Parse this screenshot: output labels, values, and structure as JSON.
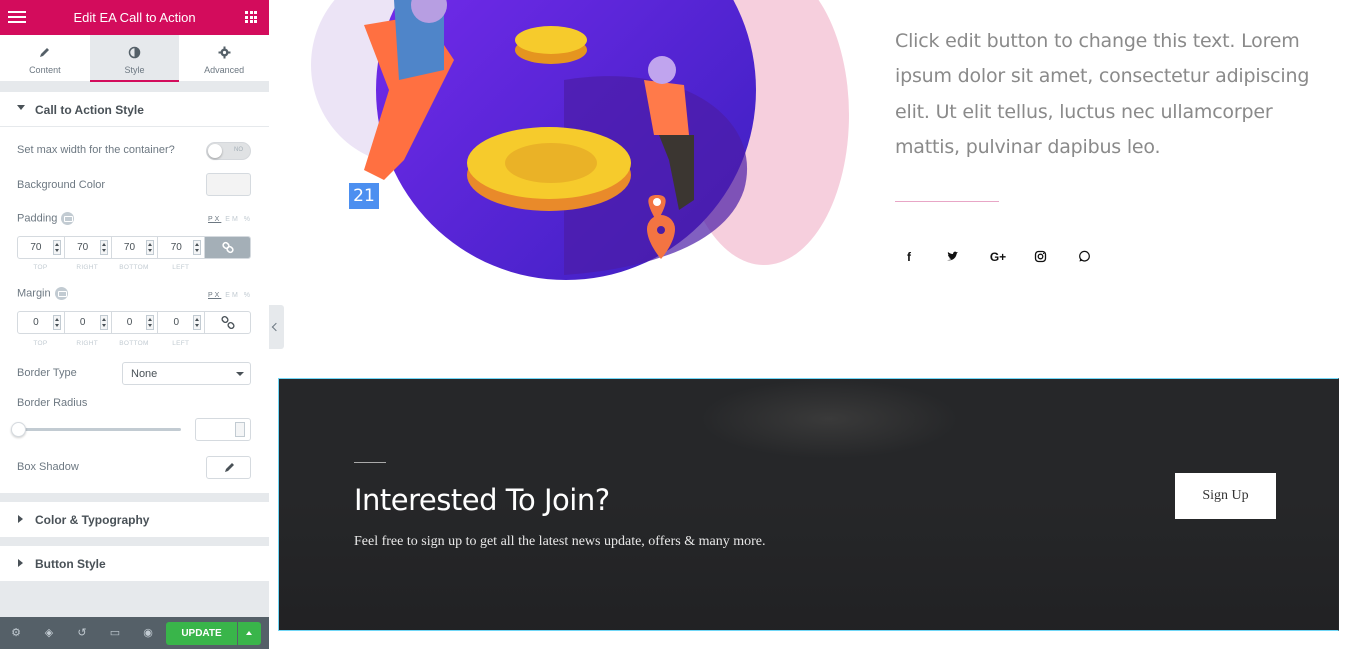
{
  "header": {
    "title": "Edit EA Call to Action"
  },
  "tabs": [
    {
      "label": "Content",
      "icon": "pencil-icon"
    },
    {
      "label": "Style",
      "icon": "contrast-icon",
      "active": true
    },
    {
      "label": "Advanced",
      "icon": "gear-icon"
    }
  ],
  "section_cta_style": {
    "title": "Call to Action Style",
    "max_width_label": "Set max width for the container?",
    "toggle_text": "NO",
    "bg_color_label": "Background Color",
    "padding_label": "Padding",
    "margin_label": "Margin",
    "units": [
      "PX",
      "EM",
      "%"
    ],
    "padding": {
      "top": "70",
      "right": "70",
      "bottom": "70",
      "left": "70"
    },
    "margin": {
      "top": "0",
      "right": "0",
      "bottom": "0",
      "left": "0"
    },
    "dim_labels": [
      "TOP",
      "RIGHT",
      "BOTTOM",
      "LEFT"
    ],
    "border_type_label": "Border Type",
    "border_type_value": "None",
    "border_radius_label": "Border Radius",
    "box_shadow_label": "Box Shadow"
  },
  "section_color": {
    "title": "Color & Typography"
  },
  "section_button": {
    "title": "Button Style"
  },
  "footer": {
    "update_label": "UPDATE"
  },
  "preview": {
    "date_badge": "21",
    "paragraph": "Click edit button to change this text. Lorem ipsum dolor sit amet, consectetur adipiscing elit. Ut elit tellus, luctus nec ullamcorper mattis, pulvinar dapibus leo.",
    "social_icons": [
      "facebook-icon",
      "twitter-icon",
      "google-plus-icon",
      "instagram-icon",
      "whatsapp-icon"
    ],
    "social_glyphs": [
      "f",
      "•",
      "G+",
      "◎",
      "○"
    ]
  },
  "cta": {
    "title": "Interested To Join?",
    "subtitle": "Feel free to sign up to get all the latest news update, offers & many more.",
    "button": "Sign Up"
  },
  "colors": {
    "brand": "#d30c5c",
    "update": "#39b54a",
    "cta_bg": "#262729"
  }
}
